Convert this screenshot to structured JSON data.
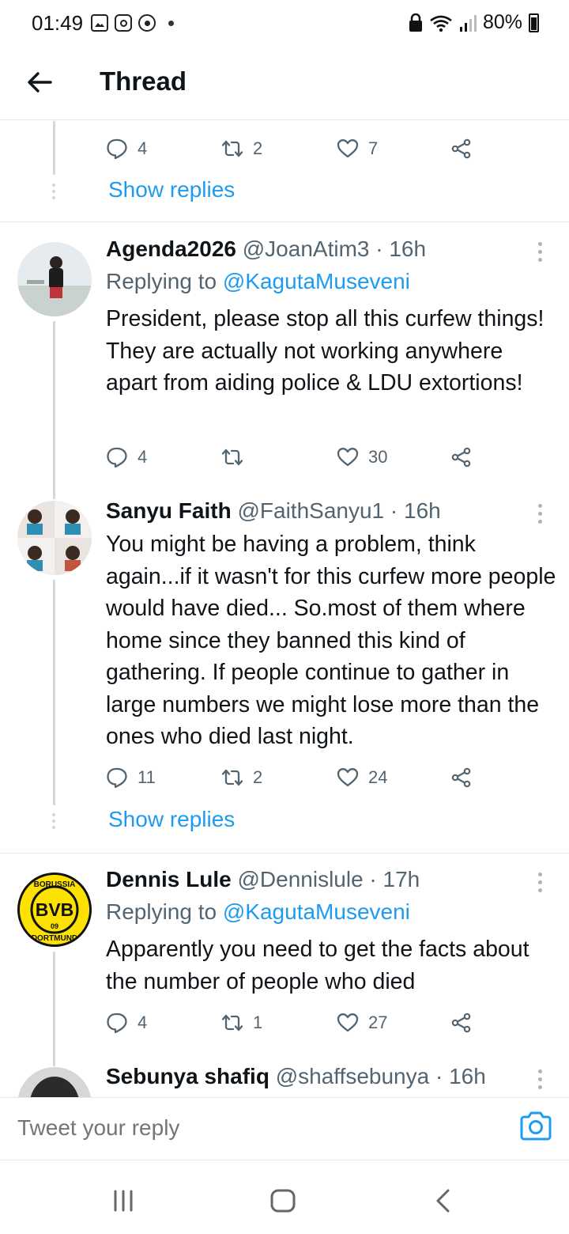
{
  "status_bar": {
    "time": "01:49",
    "battery": "80%",
    "icons_left": [
      "gallery-icon",
      "instagram-icon",
      "chrome-icon",
      "dot-icon"
    ],
    "icons_right": [
      "lock-icon",
      "wifi-icon",
      "signal-icon",
      "battery-icon"
    ]
  },
  "header": {
    "title": "Thread",
    "back_icon": "arrow-left-icon"
  },
  "top_section": {
    "actions": {
      "replies": "4",
      "retweets": "2",
      "likes": "7"
    },
    "show_replies": "Show replies"
  },
  "tweets": [
    {
      "name": "Agenda2026",
      "meta": "@JoanAtim3 · 16h",
      "replying_prefix": "Replying to",
      "replying_to": "@KagutaMuseveni",
      "text": "President, please stop all this curfew things! They are actually not working anywhere apart from aiding police & LDU extortions!",
      "actions": {
        "replies": "4",
        "retweets": "",
        "likes": "30"
      }
    },
    {
      "name": "Sanyu Faith",
      "meta": "@FaithSanyu1 · 16h",
      "text": "You might be having a problem, think again...if it wasn't for this curfew more people would have died... So.most of them where home since they banned this kind of gathering. If people continue to gather in large numbers we might lose more than the ones who died last night.",
      "actions": {
        "replies": "11",
        "retweets": "2",
        "likes": "24"
      },
      "show_replies": "Show replies"
    },
    {
      "name": "Dennis Lule",
      "meta": "@Dennislule · 17h",
      "replying_prefix": "Replying to",
      "replying_to": "@KagutaMuseveni",
      "text": "Apparently you need to get the facts about the number of people who died",
      "actions": {
        "replies": "4",
        "retweets": "1",
        "likes": "27"
      },
      "avatar_logo": {
        "top": "BORUSSIA",
        "mid": "BVB",
        "num": "09",
        "bottom": "DORTMUND"
      }
    },
    {
      "name": "Sebunya shafiq",
      "meta": "@shaffsebunya · 16h"
    }
  ],
  "composer": {
    "placeholder": "Tweet your reply",
    "icon": "camera-icon"
  },
  "navbar": {
    "icons": [
      "recent-apps-icon",
      "home-icon",
      "back-nav-icon"
    ]
  },
  "colors": {
    "accent": "#1d9bf0",
    "muted": "#536471",
    "text": "#0f1419",
    "line": "#cfd9de"
  }
}
